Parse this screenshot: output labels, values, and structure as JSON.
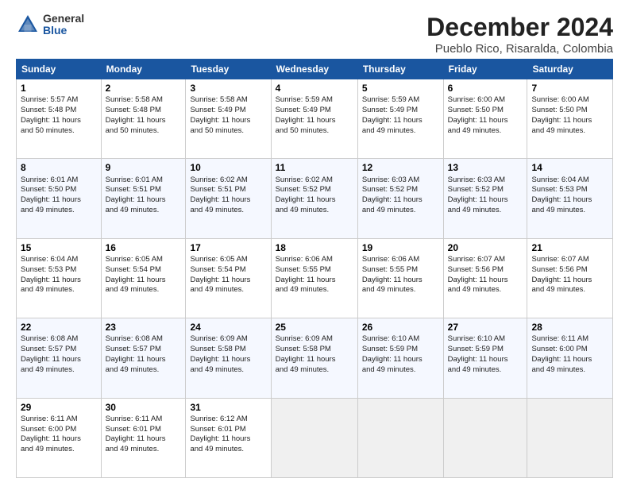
{
  "header": {
    "title": "December 2024",
    "location": "Pueblo Rico, Risaralda, Colombia",
    "logo_general": "General",
    "logo_blue": "Blue"
  },
  "days_of_week": [
    "Sunday",
    "Monday",
    "Tuesday",
    "Wednesday",
    "Thursday",
    "Friday",
    "Saturday"
  ],
  "weeks": [
    [
      {
        "day": "1",
        "info": "Sunrise: 5:57 AM\nSunset: 5:48 PM\nDaylight: 11 hours\nand 50 minutes."
      },
      {
        "day": "2",
        "info": "Sunrise: 5:58 AM\nSunset: 5:48 PM\nDaylight: 11 hours\nand 50 minutes."
      },
      {
        "day": "3",
        "info": "Sunrise: 5:58 AM\nSunset: 5:49 PM\nDaylight: 11 hours\nand 50 minutes."
      },
      {
        "day": "4",
        "info": "Sunrise: 5:59 AM\nSunset: 5:49 PM\nDaylight: 11 hours\nand 50 minutes."
      },
      {
        "day": "5",
        "info": "Sunrise: 5:59 AM\nSunset: 5:49 PM\nDaylight: 11 hours\nand 49 minutes."
      },
      {
        "day": "6",
        "info": "Sunrise: 6:00 AM\nSunset: 5:50 PM\nDaylight: 11 hours\nand 49 minutes."
      },
      {
        "day": "7",
        "info": "Sunrise: 6:00 AM\nSunset: 5:50 PM\nDaylight: 11 hours\nand 49 minutes."
      }
    ],
    [
      {
        "day": "8",
        "info": "Sunrise: 6:01 AM\nSunset: 5:50 PM\nDaylight: 11 hours\nand 49 minutes."
      },
      {
        "day": "9",
        "info": "Sunrise: 6:01 AM\nSunset: 5:51 PM\nDaylight: 11 hours\nand 49 minutes."
      },
      {
        "day": "10",
        "info": "Sunrise: 6:02 AM\nSunset: 5:51 PM\nDaylight: 11 hours\nand 49 minutes."
      },
      {
        "day": "11",
        "info": "Sunrise: 6:02 AM\nSunset: 5:52 PM\nDaylight: 11 hours\nand 49 minutes."
      },
      {
        "day": "12",
        "info": "Sunrise: 6:03 AM\nSunset: 5:52 PM\nDaylight: 11 hours\nand 49 minutes."
      },
      {
        "day": "13",
        "info": "Sunrise: 6:03 AM\nSunset: 5:52 PM\nDaylight: 11 hours\nand 49 minutes."
      },
      {
        "day": "14",
        "info": "Sunrise: 6:04 AM\nSunset: 5:53 PM\nDaylight: 11 hours\nand 49 minutes."
      }
    ],
    [
      {
        "day": "15",
        "info": "Sunrise: 6:04 AM\nSunset: 5:53 PM\nDaylight: 11 hours\nand 49 minutes."
      },
      {
        "day": "16",
        "info": "Sunrise: 6:05 AM\nSunset: 5:54 PM\nDaylight: 11 hours\nand 49 minutes."
      },
      {
        "day": "17",
        "info": "Sunrise: 6:05 AM\nSunset: 5:54 PM\nDaylight: 11 hours\nand 49 minutes."
      },
      {
        "day": "18",
        "info": "Sunrise: 6:06 AM\nSunset: 5:55 PM\nDaylight: 11 hours\nand 49 minutes."
      },
      {
        "day": "19",
        "info": "Sunrise: 6:06 AM\nSunset: 5:55 PM\nDaylight: 11 hours\nand 49 minutes."
      },
      {
        "day": "20",
        "info": "Sunrise: 6:07 AM\nSunset: 5:56 PM\nDaylight: 11 hours\nand 49 minutes."
      },
      {
        "day": "21",
        "info": "Sunrise: 6:07 AM\nSunset: 5:56 PM\nDaylight: 11 hours\nand 49 minutes."
      }
    ],
    [
      {
        "day": "22",
        "info": "Sunrise: 6:08 AM\nSunset: 5:57 PM\nDaylight: 11 hours\nand 49 minutes."
      },
      {
        "day": "23",
        "info": "Sunrise: 6:08 AM\nSunset: 5:57 PM\nDaylight: 11 hours\nand 49 minutes."
      },
      {
        "day": "24",
        "info": "Sunrise: 6:09 AM\nSunset: 5:58 PM\nDaylight: 11 hours\nand 49 minutes."
      },
      {
        "day": "25",
        "info": "Sunrise: 6:09 AM\nSunset: 5:58 PM\nDaylight: 11 hours\nand 49 minutes."
      },
      {
        "day": "26",
        "info": "Sunrise: 6:10 AM\nSunset: 5:59 PM\nDaylight: 11 hours\nand 49 minutes."
      },
      {
        "day": "27",
        "info": "Sunrise: 6:10 AM\nSunset: 5:59 PM\nDaylight: 11 hours\nand 49 minutes."
      },
      {
        "day": "28",
        "info": "Sunrise: 6:11 AM\nSunset: 6:00 PM\nDaylight: 11 hours\nand 49 minutes."
      }
    ],
    [
      {
        "day": "29",
        "info": "Sunrise: 6:11 AM\nSunset: 6:00 PM\nDaylight: 11 hours\nand 49 minutes."
      },
      {
        "day": "30",
        "info": "Sunrise: 6:11 AM\nSunset: 6:01 PM\nDaylight: 11 hours\nand 49 minutes."
      },
      {
        "day": "31",
        "info": "Sunrise: 6:12 AM\nSunset: 6:01 PM\nDaylight: 11 hours\nand 49 minutes."
      },
      {
        "day": "",
        "info": ""
      },
      {
        "day": "",
        "info": ""
      },
      {
        "day": "",
        "info": ""
      },
      {
        "day": "",
        "info": ""
      }
    ]
  ]
}
